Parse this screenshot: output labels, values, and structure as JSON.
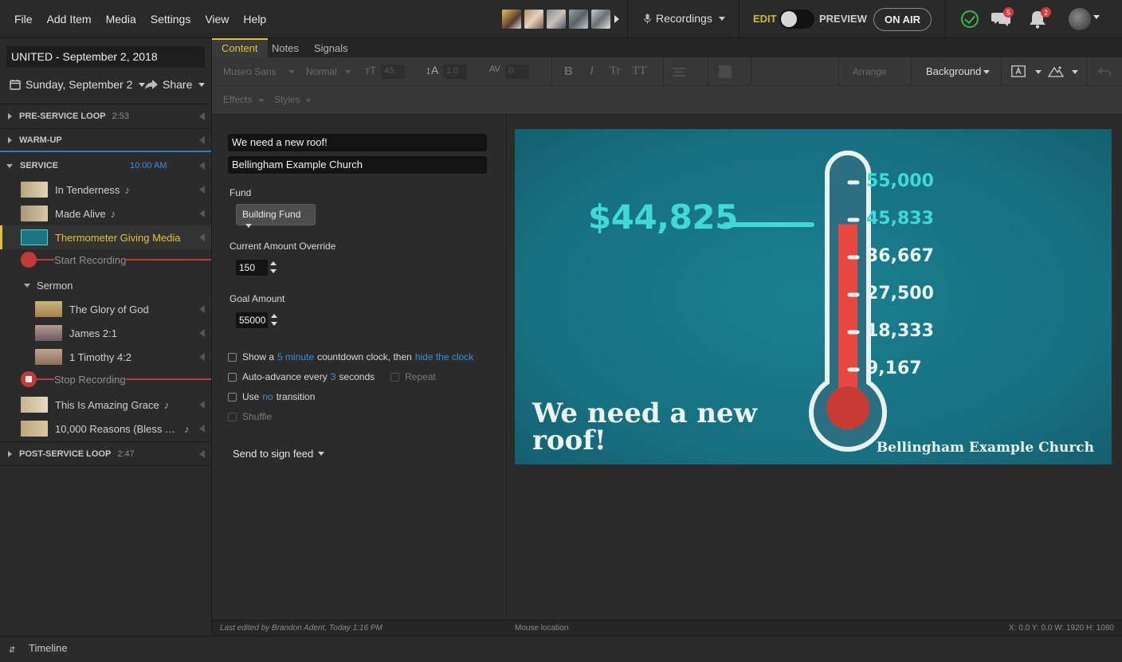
{
  "menu": [
    "File",
    "Add Item",
    "Media",
    "Settings",
    "View",
    "Help"
  ],
  "header": {
    "recordings_label": "Recordings",
    "edit_label": "EDIT",
    "preview_label": "PREVIEW",
    "onair_label": "ON AIR",
    "chat_badge": "5",
    "bell_badge": "2"
  },
  "sidebar": {
    "presentation_title": "UNITED - September 2, 2018",
    "date_label": "Sunday, September 2",
    "share_label": "Share",
    "sections": {
      "pre_service": {
        "name": "PRE-SERVICE LOOP",
        "time": "2:53"
      },
      "warm_up": {
        "name": "WARM-UP"
      },
      "service": {
        "name": "SERVICE",
        "time": "10:00 AM"
      },
      "post_service": {
        "name": "POST-SERVICE LOOP",
        "time": "2:47"
      }
    },
    "items": [
      {
        "label": "In Tenderness",
        "note": "♪"
      },
      {
        "label": "Made Alive",
        "note": "♪"
      },
      {
        "label": "Thermometer Giving Media"
      },
      {
        "label": "Start Recording"
      },
      {
        "label": "Sermon"
      },
      {
        "label": "The Glory of God"
      },
      {
        "label": "James 2:1"
      },
      {
        "label": "1 Timothy 4:2"
      },
      {
        "label": "Stop Recording"
      },
      {
        "label": "This Is Amazing Grace",
        "note": "♪"
      },
      {
        "label": "10,000 Reasons (Bless The…",
        "note": "♪"
      }
    ]
  },
  "tabs": [
    "Content",
    "Notes",
    "Signals"
  ],
  "toolbar": {
    "font": "Museo Sans",
    "weight": "Normal",
    "size": "45",
    "line_height": "1.0",
    "tracking": "0",
    "bold": "B",
    "italic": "I",
    "tr": "Tr",
    "tt": "TT",
    "arrange": "Arrange",
    "background": "Background",
    "effects": "Effects",
    "styles": "Styles"
  },
  "props": {
    "title_value": "We need a new roof!",
    "church_value": "Bellingham Example Church",
    "fund_label": "Fund",
    "fund_value": "Building Fund",
    "current_label": "Current Amount Override",
    "current_value": "150",
    "goal_label": "Goal Amount",
    "goal_value": "55000",
    "countdown_pre": "Show a",
    "countdown_value": "5 minute",
    "countdown_mid": "countdown clock, then",
    "countdown_action": "hide the clock",
    "advance_pre": "Auto-advance every",
    "advance_value": "3",
    "advance_post": "seconds",
    "repeat_label": "Repeat",
    "transition_pre": "Use",
    "transition_value": "no",
    "transition_post": "transition",
    "shuffle_label": "Shuffle",
    "send_feed": "Send to sign feed"
  },
  "slide": {
    "amount": "$44,825",
    "title": "We need a new roof!",
    "church": "Bellingham Example Church",
    "ticks": [
      "55,000",
      "45,833",
      "36,667",
      "27,500",
      "18,333",
      "9,167"
    ],
    "progress": 0.815,
    "colors": {
      "background": "#176f80",
      "mercury": "#e8473f",
      "accent": "#3fd9d6"
    }
  },
  "status": {
    "last_edited": "Last edited by Brandon Adent, Today 1:16 PM",
    "mouse_location": "Mouse location",
    "coords": "X: 0.0 Y: 0.0   W: 1920 H: 1080"
  },
  "bottom": {
    "timeline_label": "Timeline"
  }
}
